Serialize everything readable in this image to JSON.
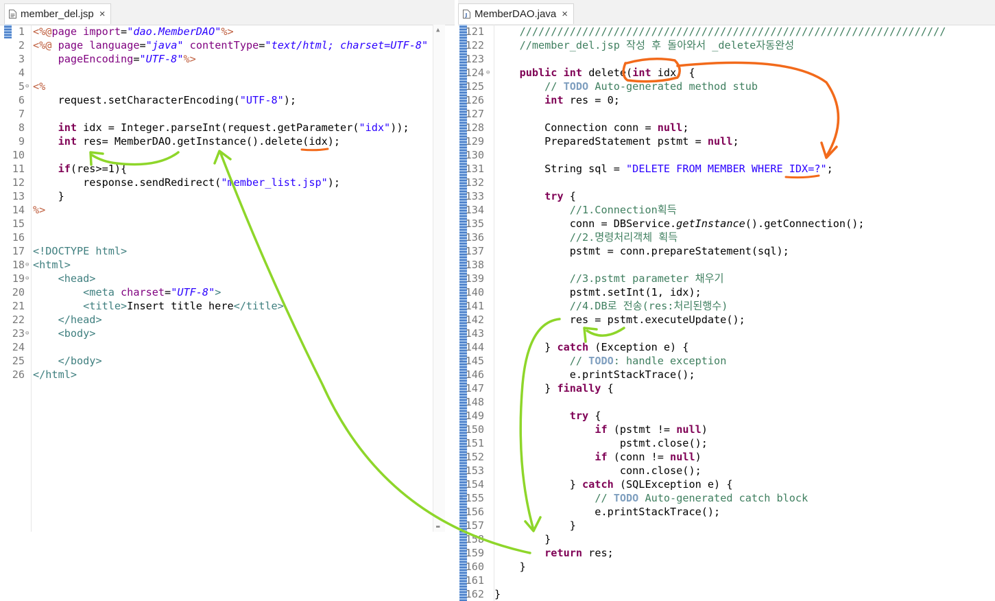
{
  "left": {
    "tab_label": "member_del.jsp",
    "close_label": "×",
    "lines": [
      {
        "n": "1",
        "html": "<span class='jsp'>&lt;%@</span><span class='att'>page</span> <span class='att'>import</span>=<span class='aval'>\"dao.MemberDAO\"</span><span class='jsp'>%&gt;</span>"
      },
      {
        "n": "2",
        "html": "<span class='jsp'>&lt;%@</span> <span class='att'>page</span> <span class='att'>language</span>=<span class='aval'>\"java\"</span> <span class='att'>contentType</span>=<span class='aval'>\"text/html; charset=UTF-8\"</span>"
      },
      {
        "n": "3",
        "html": "    <span class='att'>pageEncoding</span>=<span class='aval'>\"UTF-8\"</span><span class='jsp'>%&gt;</span>"
      },
      {
        "n": "4",
        "html": ""
      },
      {
        "n": "5",
        "html": "<span class='jsp'>&lt;%</span>",
        "fold": true
      },
      {
        "n": "6",
        "html": "    request.setCharacterEncoding(<span class='str'>\"UTF-8\"</span>);"
      },
      {
        "n": "7",
        "html": ""
      },
      {
        "n": "8",
        "html": "    <span class='kw'>int</span> idx = Integer.parseInt(request.getParameter(<span class='str'>\"idx\"</span>));"
      },
      {
        "n": "9",
        "html": "    <span class='kw'>int</span> res= MemberDAO.getInstance().delete(idx);"
      },
      {
        "n": "10",
        "html": ""
      },
      {
        "n": "11",
        "html": "    <span class='kw'>if</span>(res&gt;=1){"
      },
      {
        "n": "12",
        "html": "        response.sendRedirect(<span class='str'>\"member_list.jsp\"</span>);"
      },
      {
        "n": "13",
        "html": "    }"
      },
      {
        "n": "14",
        "html": "<span class='jsp'>%&gt;</span>"
      },
      {
        "n": "15",
        "html": ""
      },
      {
        "n": "16",
        "html": ""
      },
      {
        "n": "17",
        "html": "<span class='tag'>&lt;!DOCTYPE html&gt;</span>"
      },
      {
        "n": "18",
        "html": "<span class='tag'>&lt;html&gt;</span>",
        "fold": true
      },
      {
        "n": "19",
        "html": "    <span class='tag'>&lt;head&gt;</span>",
        "fold": true
      },
      {
        "n": "20",
        "html": "        <span class='tag'>&lt;meta</span> <span class='att'>charset</span>=<span class='aval'>\"UTF-8\"</span><span class='tag'>&gt;</span>"
      },
      {
        "n": "21",
        "html": "        <span class='tag'>&lt;title&gt;</span>Insert title here<span class='tag'>&lt;/title&gt;</span>"
      },
      {
        "n": "22",
        "html": "    <span class='tag'>&lt;/head&gt;</span>"
      },
      {
        "n": "23",
        "html": "    <span class='tag'>&lt;body&gt;</span>",
        "fold": true
      },
      {
        "n": "24",
        "html": ""
      },
      {
        "n": "25",
        "html": "    <span class='tag'>&lt;/body&gt;</span>"
      },
      {
        "n": "26",
        "html": "<span class='tag'>&lt;/html&gt;</span>"
      }
    ]
  },
  "right": {
    "tab_label": "MemberDAO.java",
    "close_label": "×",
    "lines": [
      {
        "n": "121",
        "html": "    <span class='cm'>////////////////////////////////////////////////////////////////////</span>"
      },
      {
        "n": "122",
        "html": "    <span class='cm'>//member_del.jsp 작성 후 돌아와서 _delete자동완성</span>"
      },
      {
        "n": "123",
        "html": ""
      },
      {
        "n": "124",
        "html": "    <span class='kw'>public</span> <span class='kw'>int</span> delete(<span class='kw'>int</span> idx) {",
        "fold": true
      },
      {
        "n": "125",
        "html": "        <span class='cm'>// </span><span class='todo'>TODO</span><span class='cm'> Auto-generated method stub</span>",
        "mark": true
      },
      {
        "n": "126",
        "html": "        <span class='kw'>int</span> res = 0;"
      },
      {
        "n": "127",
        "html": ""
      },
      {
        "n": "128",
        "html": "        Connection conn = <span class='kw'>null</span>;"
      },
      {
        "n": "129",
        "html": "        PreparedStatement pstmt = <span class='kw'>null</span>;"
      },
      {
        "n": "130",
        "html": ""
      },
      {
        "n": "131",
        "html": "        String sql = <span class='str'>\"DELETE FROM MEMBER WHERE IDX=?\"</span>;"
      },
      {
        "n": "132",
        "html": ""
      },
      {
        "n": "133",
        "html": "        <span class='kw'>try</span> {"
      },
      {
        "n": "134",
        "html": "            <span class='cm'>//1.Connection획득</span>"
      },
      {
        "n": "135",
        "html": "            conn = DBService.<span class='ital'>getInstance</span>().getConnection();"
      },
      {
        "n": "136",
        "html": "            <span class='cm'>//2.명령처리객체 획득</span>"
      },
      {
        "n": "137",
        "html": "            pstmt = conn.prepareStatement(sql);"
      },
      {
        "n": "138",
        "html": ""
      },
      {
        "n": "139",
        "html": "            <span class='cm'>//3.pstmt parameter 채우기</span>"
      },
      {
        "n": "140",
        "html": "            pstmt.setInt(1, idx);"
      },
      {
        "n": "141",
        "html": "            <span class='cm'>//4.DB로 전송(res:처리된행수)</span>"
      },
      {
        "n": "142",
        "html": "            res = pstmt.executeUpdate();"
      },
      {
        "n": "143",
        "html": ""
      },
      {
        "n": "144",
        "html": "        } <span class='kw'>catch</span> (Exception e) {"
      },
      {
        "n": "145",
        "html": "            <span class='cm'>// </span><span class='todo'>TODO</span><span class='cm'>: handle exception</span>",
        "mark": true
      },
      {
        "n": "146",
        "html": "            e.printStackTrace();"
      },
      {
        "n": "147",
        "html": "        } <span class='kw'>finally</span> {"
      },
      {
        "n": "148",
        "html": ""
      },
      {
        "n": "149",
        "html": "            <span class='kw'>try</span> {"
      },
      {
        "n": "150",
        "html": "                <span class='kw'>if</span> (pstmt != <span class='kw'>null</span>)"
      },
      {
        "n": "151",
        "html": "                    pstmt.close();"
      },
      {
        "n": "152",
        "html": "                <span class='kw'>if</span> (conn != <span class='kw'>null</span>)"
      },
      {
        "n": "153",
        "html": "                    conn.close();"
      },
      {
        "n": "154",
        "html": "            } <span class='kw'>catch</span> (SQLException e) {"
      },
      {
        "n": "155",
        "html": "                <span class='cm'>// </span><span class='todo'>TODO</span><span class='cm'> Auto-generated catch block</span>",
        "mark": true
      },
      {
        "n": "156",
        "html": "                e.printStackTrace();"
      },
      {
        "n": "157",
        "html": "            }"
      },
      {
        "n": "158",
        "html": "        }"
      },
      {
        "n": "159",
        "html": "        <span class='kw'>return</span> res;"
      },
      {
        "n": "160",
        "html": "    }"
      },
      {
        "n": "161",
        "html": ""
      },
      {
        "n": "162",
        "html": "}"
      }
    ]
  },
  "colors": {
    "annotation_green": "#8ed62a",
    "annotation_orange": "#f26a1b",
    "gutter_blue": "#5a8fd6"
  }
}
